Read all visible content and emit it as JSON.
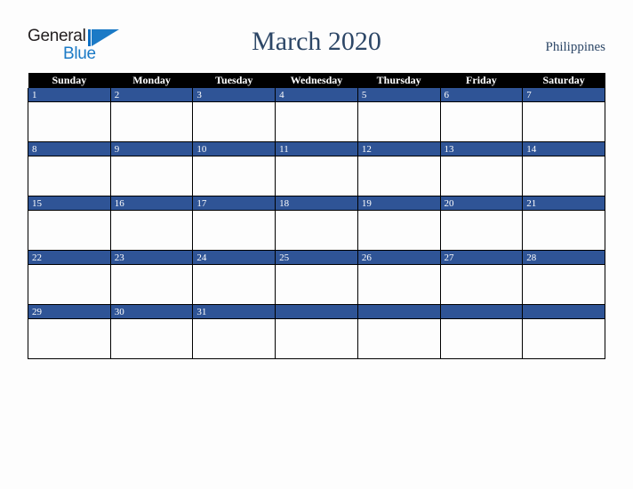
{
  "brand": {
    "name_part1": "General",
    "name_part2": "Blue",
    "logo_icon": "triangle-flag-icon",
    "accent_color": "#1b7ac6"
  },
  "header": {
    "title": "March 2020",
    "country": "Philippines",
    "title_color": "#2d4767"
  },
  "calendar": {
    "month": "March",
    "year": "2020",
    "header_background": "#000000",
    "daynum_background": "#2f5496",
    "weekday_headers": [
      "Sunday",
      "Monday",
      "Tuesday",
      "Wednesday",
      "Thursday",
      "Friday",
      "Saturday"
    ],
    "weeks": [
      [
        "1",
        "2",
        "3",
        "4",
        "5",
        "6",
        "7"
      ],
      [
        "8",
        "9",
        "10",
        "11",
        "12",
        "13",
        "14"
      ],
      [
        "15",
        "16",
        "17",
        "18",
        "19",
        "20",
        "21"
      ],
      [
        "22",
        "23",
        "24",
        "25",
        "26",
        "27",
        "28"
      ],
      [
        "29",
        "30",
        "31",
        "",
        "",
        "",
        ""
      ]
    ]
  }
}
